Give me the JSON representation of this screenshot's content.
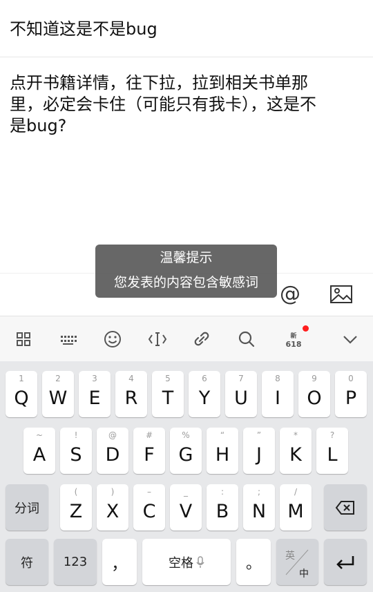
{
  "post": {
    "title": "不知道这是不是bug",
    "body": "点开书籍详情，往下拉，拉到相关书单那\n里，必定会卡住（可能只有我卡），这是不\n是bug?"
  },
  "attach": {
    "at_label": "@"
  },
  "toast": {
    "title": "温馨提示",
    "message": "您发表的内容包含敏感词"
  },
  "toolbar": {
    "icons": [
      "grid-icon",
      "keyboard-icon",
      "emoji-icon",
      "cursor-icon",
      "link-icon",
      "search-icon",
      "promo-618-icon",
      "collapse-icon"
    ],
    "promo_top": "新",
    "promo_bottom": "618"
  },
  "keyboard": {
    "row1": [
      {
        "main": "Q",
        "sub": "1"
      },
      {
        "main": "W",
        "sub": "2"
      },
      {
        "main": "E",
        "sub": "3"
      },
      {
        "main": "R",
        "sub": "4"
      },
      {
        "main": "T",
        "sub": "5"
      },
      {
        "main": "Y",
        "sub": "6"
      },
      {
        "main": "U",
        "sub": "7"
      },
      {
        "main": "I",
        "sub": "8"
      },
      {
        "main": "O",
        "sub": "9"
      },
      {
        "main": "P",
        "sub": "0"
      }
    ],
    "row2": [
      {
        "main": "A",
        "sub": "~"
      },
      {
        "main": "S",
        "sub": "!"
      },
      {
        "main": "D",
        "sub": "@"
      },
      {
        "main": "F",
        "sub": "#"
      },
      {
        "main": "G",
        "sub": "%"
      },
      {
        "main": "H",
        "sub": "“"
      },
      {
        "main": "J",
        "sub": "”"
      },
      {
        "main": "K",
        "sub": "*"
      },
      {
        "main": "L",
        "sub": "?"
      }
    ],
    "row3": [
      {
        "main": "Z",
        "sub": "("
      },
      {
        "main": "X",
        "sub": ")"
      },
      {
        "main": "C",
        "sub": "–"
      },
      {
        "main": "V",
        "sub": "_"
      },
      {
        "main": "B",
        "sub": ":"
      },
      {
        "main": "N",
        "sub": ";"
      },
      {
        "main": "M",
        "sub": "/"
      }
    ],
    "segment_label": "分词",
    "symbol_label": "符",
    "number_label": "123",
    "comma_label": "，",
    "space_label": "空格",
    "period_label": "。",
    "lang_en": "英",
    "lang_zh": "中"
  }
}
